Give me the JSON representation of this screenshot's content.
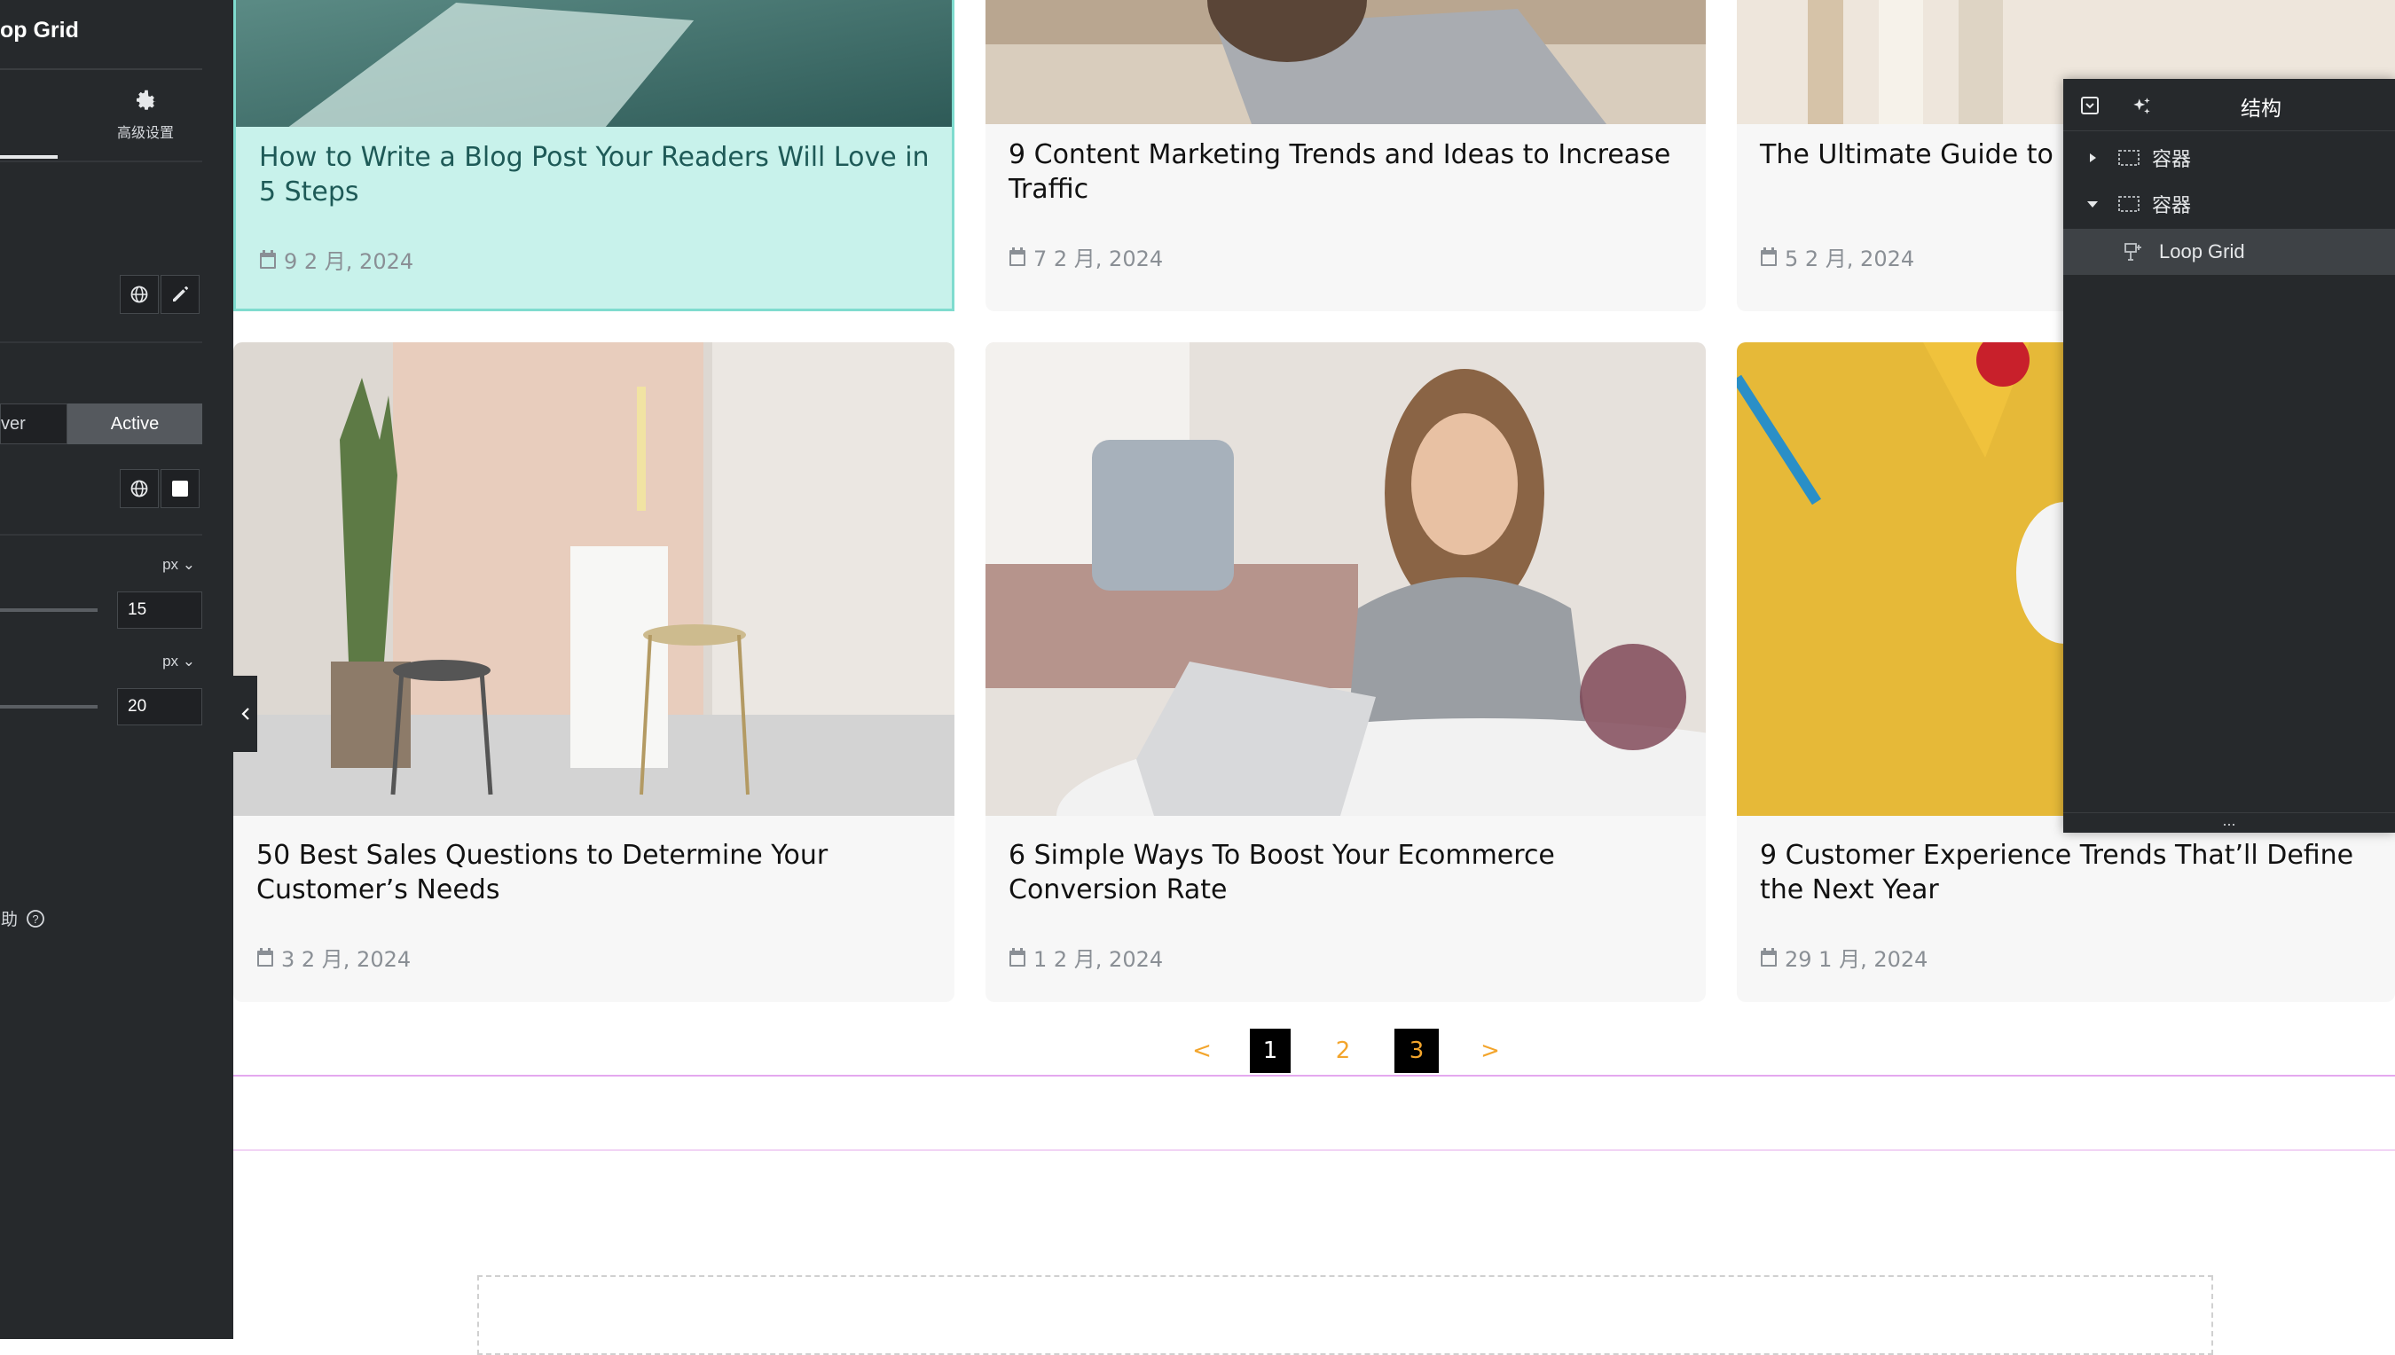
{
  "editor": {
    "title": "op Grid",
    "tab_advanced_label": "高级设置",
    "state_hover_label": "ver",
    "state_active_label": "Active",
    "unit_1": "px",
    "value_1": "15",
    "unit_2": "px",
    "value_2": "20",
    "help_label": "帮助"
  },
  "posts": [
    {
      "title": "How to Write a Blog Post Your Readers Will Love in 5 Steps",
      "date": "9 2 月, 2024"
    },
    {
      "title": "9 Content Marketing Trends and Ideas to Increase Traffic",
      "date": "7 2 月, 2024"
    },
    {
      "title": "The Ultimate Guide to Improve Sales",
      "date": "5 2 月, 2024"
    },
    {
      "title": "50 Best Sales Questions to Determine Your Customer’s Needs",
      "date": "3 2 月, 2024"
    },
    {
      "title": "6 Simple Ways To Boost Your Ecommerce Conversion Rate",
      "date": "1 2 月, 2024"
    },
    {
      "title": "9 Customer Experience Trends That’ll Define the Next Year",
      "date": "29 1 月, 2024"
    }
  ],
  "pagination": {
    "prev": "<",
    "p1": "1",
    "p2": "2",
    "p3": "3",
    "next": ">"
  },
  "structure": {
    "title": "结构",
    "items": [
      {
        "label": "容器"
      },
      {
        "label": "容器"
      },
      {
        "label": "Loop Grid"
      }
    ],
    "resize_handle": "..."
  },
  "colors": {
    "panel_bg": "#26292c",
    "highlight_card_bg": "#c8f2eb",
    "highlight_border": "#7fdccf",
    "pagination_accent": "#f3a52c",
    "section_outline": "#e4a8ef"
  }
}
